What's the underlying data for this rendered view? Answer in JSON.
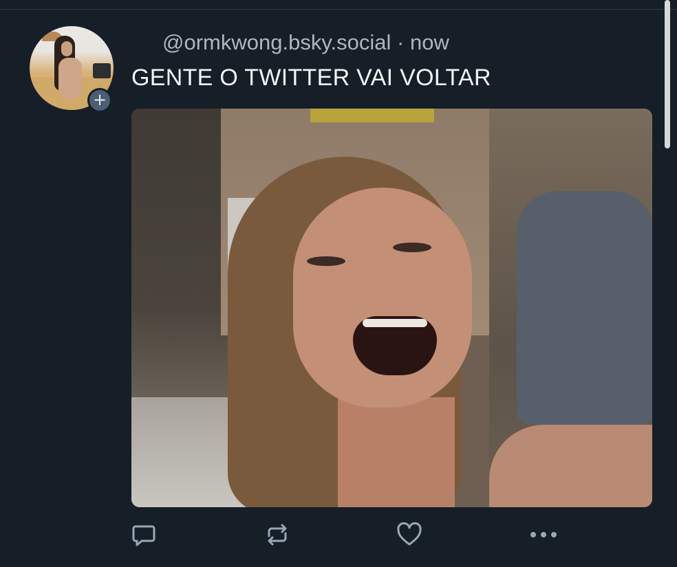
{
  "post": {
    "handle": "@ormkwong.bsky.social",
    "separator": "·",
    "time": "now",
    "text": "GENTE O TWITTER VAI VOLTAR",
    "follow_badge": "+"
  },
  "media": {
    "kind": "image",
    "description_icon": "laughing-woman-photo"
  },
  "actions": [
    {
      "name": "reply",
      "icon": "speech-bubble-icon"
    },
    {
      "name": "repost",
      "icon": "repost-arrows-icon"
    },
    {
      "name": "like",
      "icon": "heart-icon"
    },
    {
      "name": "more",
      "icon": "ellipsis-icon"
    }
  ],
  "colors": {
    "background": "#161e27",
    "text": "#f3f5f7",
    "muted": "#aeb6bf",
    "icon": "#9aa8b8",
    "badge": "#4b5e74"
  }
}
